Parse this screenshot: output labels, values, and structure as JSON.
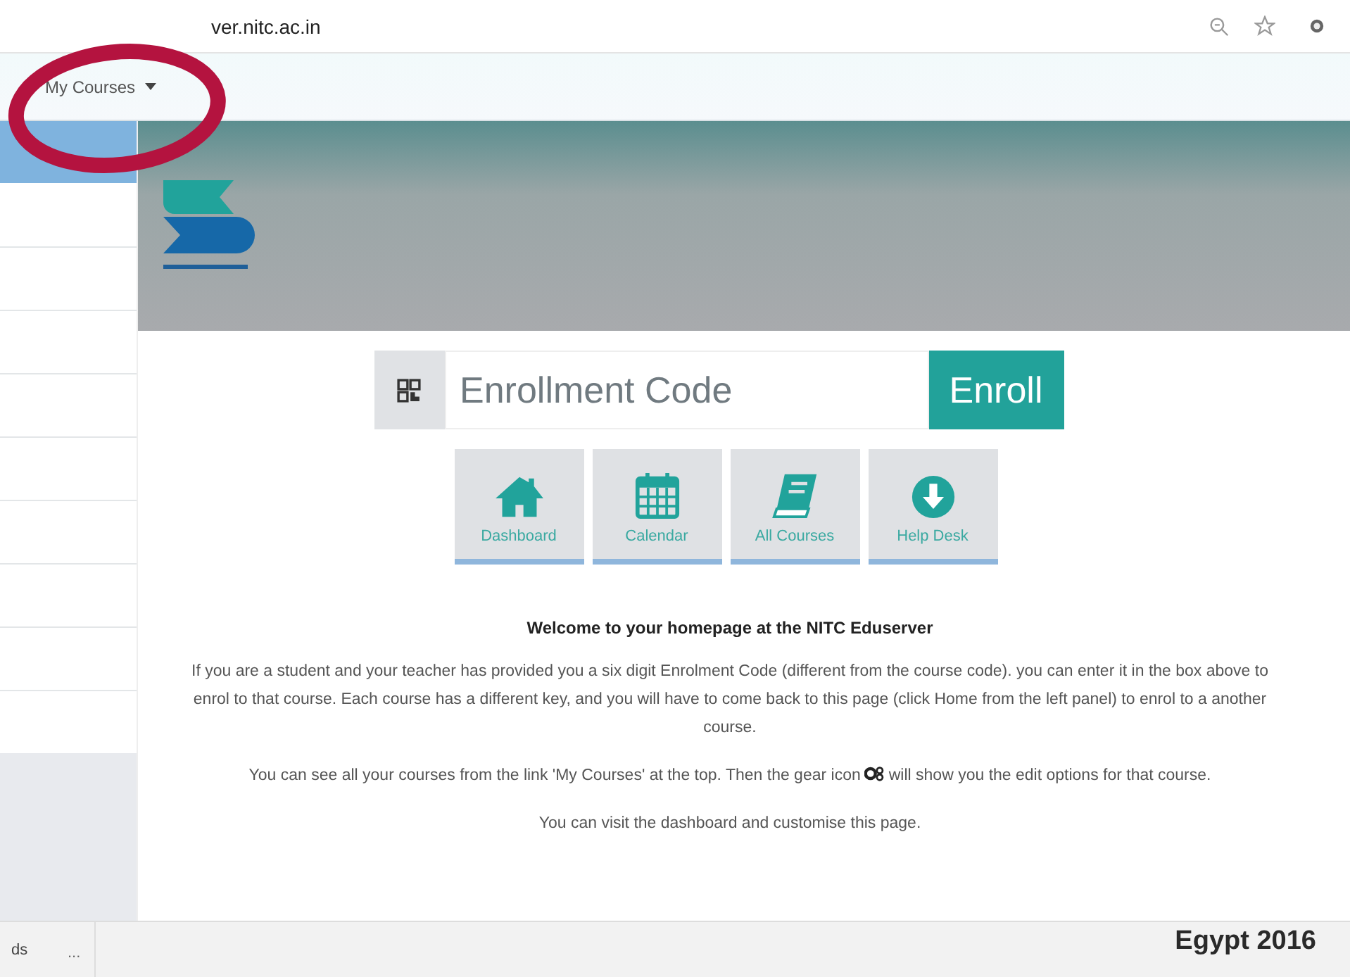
{
  "address_bar": {
    "url": "ver.nitc.ac.in"
  },
  "nav": {
    "menu_label": "My Courses"
  },
  "annotation": {
    "kind": "ellipse"
  },
  "enroll": {
    "placeholder": "Enrollment Code",
    "button": "Enroll"
  },
  "tiles": [
    {
      "kind": "home",
      "label": "Dashboard"
    },
    {
      "kind": "calendar",
      "label": "Calendar"
    },
    {
      "kind": "book",
      "label": "All Courses"
    },
    {
      "kind": "download",
      "label": "Help Desk"
    }
  ],
  "welcome": {
    "title": "Welcome to your homepage at the NITC Eduserver",
    "paragraph_1": "If you are a student and your teacher has provided you a six digit Enrolment Code (different from the course code). you can enter it in the box above to enrol to that course. Each course has a different key, and you will have to come back to this page (click Home from the left panel) to enrol to a another course.",
    "paragraph_2_before": "You can see all your courses from the link 'My Courses' at the top. Then the gear icon",
    "paragraph_2_after": "will show you the edit options for that course.",
    "paragraph_3": "You can visit the dashboard and customise this page."
  },
  "bottom_bar": {
    "item": "ds",
    "more": "..."
  },
  "caption": "Egypt 2016"
}
